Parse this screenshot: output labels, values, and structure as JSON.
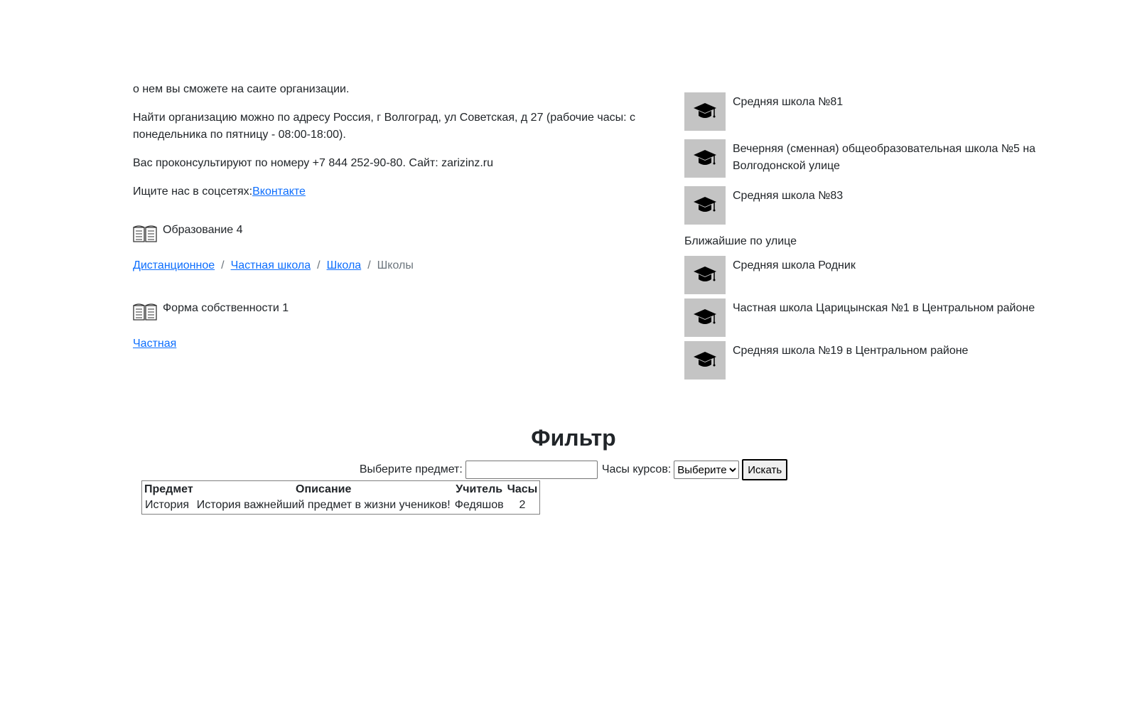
{
  "about": {
    "line1": "о нем вы сможете на саите организации.",
    "address": "Найти организацию можно по адресу Россия, г Волгоград, ул Советская, д 27 (рабочие часы: с понедельника по пятницу - 08:00-18:00).",
    "phone": "Вас проконсультируют по номеру +7 844 252-90-80. Сайт: zarizinz.ru",
    "social_prefix": "Ищите нас в соцсетях:",
    "social_link": "Вконтакте"
  },
  "education": {
    "title": "Образование 4",
    "crumbs": [
      "Дистанционное",
      "Частная школа",
      "Школа"
    ],
    "crumb_active": "Школы",
    "separator": "/"
  },
  "ownership": {
    "title": "Форма собственности 1",
    "link": "Частная"
  },
  "schools": [
    {
      "name": "Средняя школа №81"
    },
    {
      "name": "Вечерняя (сменная) общеобразовательная школа №5 на Волгодонской улице"
    },
    {
      "name": "Средняя школа №83"
    }
  ],
  "nearby": {
    "title": "Ближайшие по улице",
    "items": [
      {
        "name": "Средняя школа Родник"
      },
      {
        "name": "Частная школа Царицынская №1 в Центральном районе"
      },
      {
        "name": "Средняя школа №19 в Центральном районе"
      }
    ]
  },
  "filter": {
    "title": "Фильтр",
    "subject_label": "Выберите предмет:",
    "subject_value": "",
    "hours_label": "Часы курсов:",
    "hours_selected": "Выберите",
    "search_button": "Искать"
  },
  "table": {
    "headers": [
      "Предмет",
      "Описание",
      "Учитель",
      "Часы"
    ],
    "rows": [
      [
        "История",
        "История важнейший предмет в жизни учеников!",
        "Федяшов",
        "2"
      ]
    ]
  },
  "icons": {
    "section_icon": "book-icon",
    "school_icon": "graduation-cap-icon"
  },
  "colors": {
    "link": "#0d6efd",
    "thumb_bg": "#c4c4c4",
    "text": "#212529"
  }
}
